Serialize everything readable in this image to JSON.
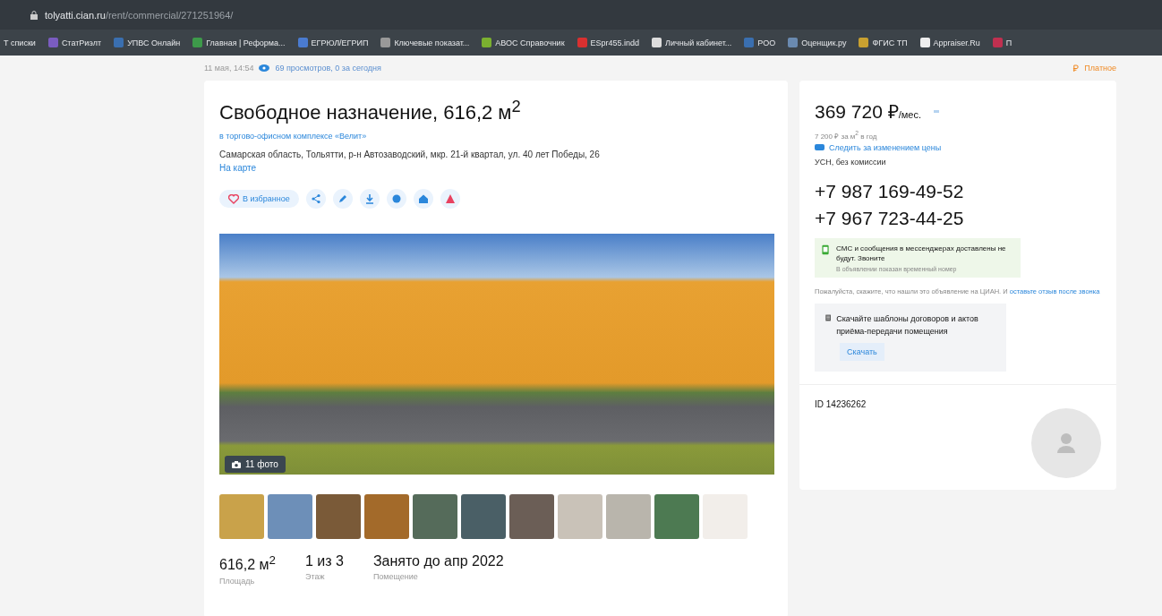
{
  "browser": {
    "url_host": "tolyatti.cian.ru",
    "url_path": "/rent/commercial/271251964/",
    "bookmarks": [
      "Т списки",
      "СтатРиэлт",
      "УПВС Онлайн",
      "Главная | Реформа...",
      "ЕГРЮЛ/ЕГРИП",
      "Ключевые показат...",
      "АВОС Справочник",
      "ESpr455.indd",
      "Личный кабинет...",
      "РОО",
      "Оценщик.ру",
      "ФГИС ТП",
      "Appraiser.Ru",
      "П"
    ]
  },
  "meta": {
    "date": "11 мая, 14:54",
    "views": "69 просмотров, 0 за сегодня",
    "paid": "Платное"
  },
  "listing": {
    "title": "Свободное назначение, 616,2 м$^{2}$",
    "complex": "в торгово-офисном комплексе «Велит»",
    "address": "Самарская область, Тольятти, р-н Автозаводский, мкр. 21-й квартал, ул. 40 лет Победы, 26",
    "map_link": "На карте",
    "favorite": "В избранное",
    "photo_count": "11 фото",
    "facts": [
      {
        "value": "616,2 м$^{2}$",
        "label": "Площадь"
      },
      {
        "value": "1 из 3",
        "label": "Этаж"
      },
      {
        "value": "Занято до апр 2022",
        "label": "Помещение"
      }
    ]
  },
  "sidebar": {
    "price": "369 720 ₽",
    "price_unit": "/мес.",
    "price_per_m": "7 200 ₽ за м$^{2}$ в год",
    "watch_price": "Следить за изменением цены",
    "terms": "УСН, без комиссии",
    "phones": [
      "+7 987 169-49-52",
      "+7 967 723-44-25"
    ],
    "notice": "СМС и сообщения в мессенджерах доставлены не будут. Звоните",
    "notice_hint": "В объявлении показан временный номер",
    "ask_text": "Пожалуйста, скажите, что нашли это объявление на ЦИАН. И",
    "ask_link": "оставьте отзыв после звонка",
    "templates": "Скачайте шаблоны договоров и актов приёма-передачи помещения",
    "download": "Скачать",
    "id": "ID 14236262"
  }
}
